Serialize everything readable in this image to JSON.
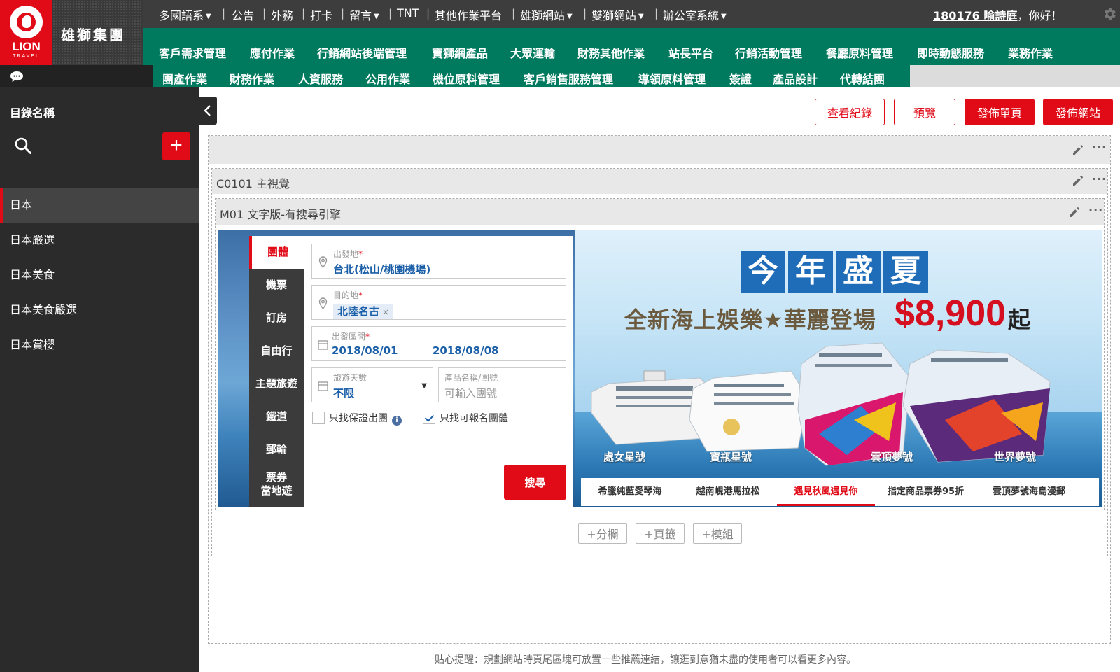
{
  "brand": {
    "logo_text": "LION",
    "logo_sub": "TRAVEL",
    "name": "雄獅集團"
  },
  "topbar": {
    "items": [
      "多國語系",
      "公告",
      "外務",
      "打卡",
      "留言",
      "TNT",
      "其他作業平台",
      "雄獅網站",
      "雙獅網站",
      "辦公室系統"
    ],
    "user_id_name": "180176 喻詩庭",
    "greeting": "，你好！"
  },
  "nav_primary": [
    "客戶需求管理",
    "應付作業",
    "行銷網站後端管理",
    "寶獅網產品",
    "大眾運輸",
    "財務其他作業",
    "站長平台",
    "行銷活動管理",
    "餐廳原料管理",
    "即時動態服務",
    "業務作業"
  ],
  "nav_secondary": [
    "團產作業",
    "財務作業",
    "人資服務",
    "公用作業",
    "機位原料管理",
    "客戶銷售服務管理",
    "導領原料管理",
    "簽證",
    "產品設計",
    "代轉結團"
  ],
  "sidebar": {
    "title": "目錄名稱",
    "add_label": "+",
    "items": [
      "日本",
      "日本嚴選",
      "日本美食",
      "日本美食嚴選",
      "日本賞櫻"
    ]
  },
  "actions": {
    "history": "查看紀錄",
    "preview": "預覽",
    "publish_page": "發佈單頁",
    "publish_site": "發佈網站"
  },
  "editor": {
    "section_label": "C0101 主視覺",
    "module_label": "M01 文字版-有搜尋引擎",
    "more": "···"
  },
  "search": {
    "tabs": [
      "團體",
      "機票",
      "訂房",
      "自由行",
      "主題旅遊",
      "鐵道",
      "郵輪",
      "票券",
      "當地遊"
    ],
    "origin_label": "出發地",
    "origin_value": "台北(松山/桃園機場)",
    "dest_label": "目的地",
    "dest_tag": "北陸名古",
    "date_label": "出發區間",
    "date_start": "2018/08/01",
    "date_sep": "~",
    "date_end": "2018/08/08",
    "days_label": "旅遊天數",
    "days_value": "不限",
    "product_label": "產品名稱/團號",
    "product_placeholder": "可輸入團號",
    "guarantee_label": "只找保證出團",
    "available_label": "只找可報名團體",
    "search_label": "搜尋"
  },
  "hero": {
    "title_chars": [
      "今",
      "年",
      "盛",
      "夏"
    ],
    "subtitle": "全新海上娛樂★華麗登場",
    "price": "$8,900",
    "price_suffix": "起",
    "ships": [
      "處女星號",
      "寶瓶星號",
      "雲頂夢號",
      "世界夢號"
    ]
  },
  "promo_tabs": [
    "希臘純藍愛琴海",
    "越南峴港馬拉松",
    "遇見秋風遇見你",
    "指定商品票券95折",
    "雲頂夢號海島漫郵"
  ],
  "add_buttons": [
    "+分欄",
    "+頁籤",
    "+模組"
  ],
  "footer_tip": "貼心提醒：規劃網站時頁尾區塊可放置一些推薦連結，讓逛到意猶未盡的使用者可以看更多內容。",
  "colors": {
    "brand_red": "#e10a17",
    "nav_green": "#007a5e",
    "dark": "#2b2b2b"
  }
}
